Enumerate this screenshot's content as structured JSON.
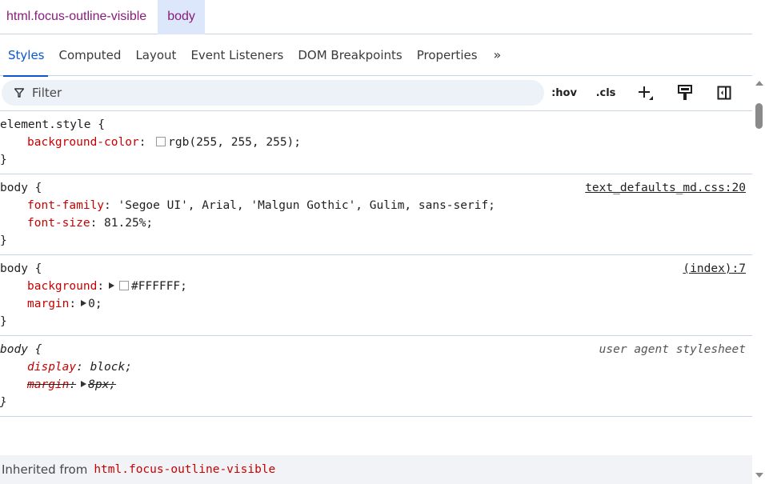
{
  "breadcrumb": {
    "items": [
      "html.focus-outline-visible",
      "body"
    ]
  },
  "tabs": {
    "items": [
      "Styles",
      "Computed",
      "Layout",
      "Event Listeners",
      "DOM Breakpoints",
      "Properties"
    ],
    "more": "»"
  },
  "toolbar": {
    "filter_placeholder": "Filter",
    "hov": ":hov",
    "cls": ".cls"
  },
  "rules": [
    {
      "selector": "element.style {",
      "source": "",
      "props": [
        {
          "name": "background-color",
          "value": "rgb(255, 255, 255);",
          "swatch": true,
          "expander": false,
          "struck": false
        }
      ],
      "close": "}"
    },
    {
      "selector": "body {",
      "source": "text_defaults_md.css:20",
      "props": [
        {
          "name": "font-family",
          "value": "'Segoe UI', Arial, 'Malgun Gothic', Gulim, sans-serif;",
          "swatch": false,
          "expander": false,
          "struck": false
        },
        {
          "name": "font-size",
          "value": "81.25%;",
          "swatch": false,
          "expander": false,
          "struck": false
        }
      ],
      "close": "}"
    },
    {
      "selector": "body {",
      "source": "(index):7",
      "props": [
        {
          "name": "background",
          "value": "#FFFFFF;",
          "swatch": true,
          "expander": true,
          "struck": false
        },
        {
          "name": "margin",
          "value": "0;",
          "swatch": false,
          "expander": true,
          "struck": false
        }
      ],
      "close": "}"
    },
    {
      "selector": "body {",
      "source": "user agent stylesheet",
      "props": [
        {
          "name": "display",
          "value": "block;",
          "swatch": false,
          "expander": false,
          "struck": false
        },
        {
          "name": "margin",
          "value": "8px;",
          "swatch": false,
          "expander": true,
          "struck": true
        }
      ],
      "close": "}"
    }
  ],
  "inherited": {
    "label": "Inherited from",
    "selector": "html.focus-outline-visible"
  },
  "colors": {
    "accent": "#0b57d0",
    "property_name": "#c80000",
    "breadcrumb_text": "#8a1c7c",
    "breadcrumb_active_bg": "#dce7fb"
  }
}
